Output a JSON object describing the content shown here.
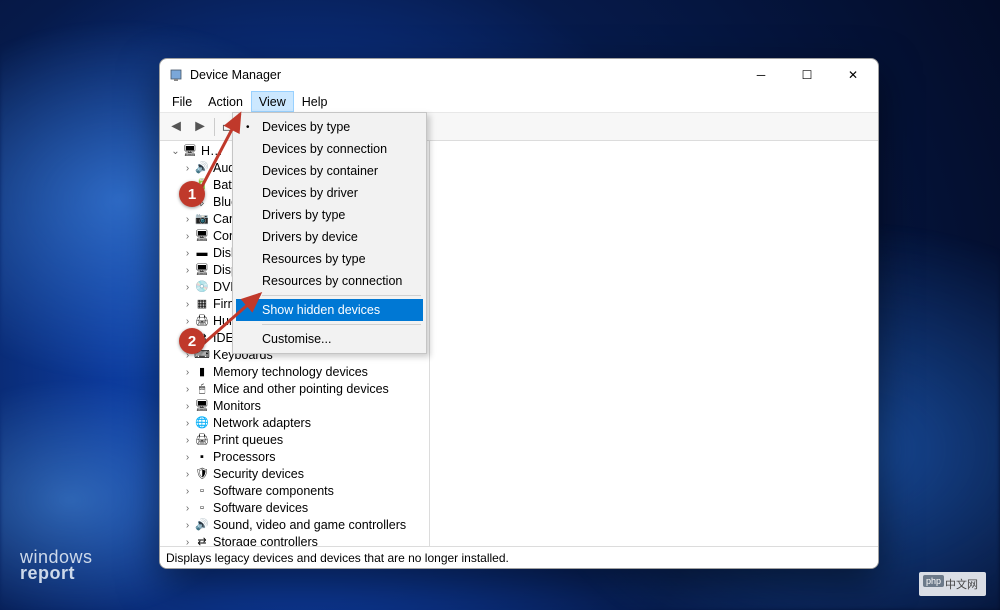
{
  "window": {
    "title": "Device Manager",
    "minimize_glyph": "─",
    "maximize_glyph": "☐",
    "close_glyph": "✕"
  },
  "menubar": {
    "items": [
      {
        "label": "File",
        "open": false
      },
      {
        "label": "Action",
        "open": false
      },
      {
        "label": "View",
        "open": true
      },
      {
        "label": "Help",
        "open": false
      }
    ]
  },
  "toolbar": {
    "back_glyph": "◄",
    "forward_glyph": "►",
    "icons_glyph": "▭"
  },
  "view_menu": {
    "items": [
      {
        "label": "Devices by type",
        "bullet": true
      },
      {
        "label": "Devices by connection"
      },
      {
        "label": "Devices by container"
      },
      {
        "label": "Devices by driver"
      },
      {
        "label": "Drivers by type"
      },
      {
        "label": "Drivers by device"
      },
      {
        "label": "Resources by type"
      },
      {
        "label": "Resources by connection"
      },
      {
        "sep": true
      },
      {
        "label": "Show hidden devices",
        "highlighted": true
      },
      {
        "sep": true
      },
      {
        "label": "Customise..."
      }
    ]
  },
  "tree": {
    "root_label": "H…",
    "nodes": [
      {
        "icon": "🔊",
        "label": "Aud"
      },
      {
        "icon": "🔋",
        "label": "Batt"
      },
      {
        "icon": "ᛒ",
        "label": "Blue"
      },
      {
        "icon": "📷",
        "label": "Cam"
      },
      {
        "icon": "🖥",
        "label": "Con"
      },
      {
        "icon": "▬",
        "label": "Disk"
      },
      {
        "icon": "🖥",
        "label": "Disp"
      },
      {
        "icon": "💿",
        "label": "DVD"
      },
      {
        "icon": "▦",
        "label": "Firm"
      },
      {
        "icon": "🖨",
        "label": "Hum"
      },
      {
        "icon": "⇄",
        "label": "IDE A…"
      },
      {
        "icon": "⌨",
        "label": "Keyboards"
      },
      {
        "icon": "▮",
        "label": "Memory technology devices"
      },
      {
        "icon": "🖱",
        "label": "Mice and other pointing devices"
      },
      {
        "icon": "🖥",
        "label": "Monitors"
      },
      {
        "icon": "🌐",
        "label": "Network adapters"
      },
      {
        "icon": "🖨",
        "label": "Print queues"
      },
      {
        "icon": "▪",
        "label": "Processors"
      },
      {
        "icon": "🛡",
        "label": "Security devices"
      },
      {
        "icon": "▫",
        "label": "Software components"
      },
      {
        "icon": "▫",
        "label": "Software devices"
      },
      {
        "icon": "🔊",
        "label": "Sound, video and game controllers"
      },
      {
        "icon": "⇄",
        "label": "Storage controllers"
      }
    ]
  },
  "statusbar": {
    "text": "Displays legacy devices and devices that are no longer installed."
  },
  "callouts": {
    "c1": "1",
    "c2": "2"
  },
  "watermark_left_1": "windows",
  "watermark_left_2": "report",
  "watermark_right": "中文网"
}
